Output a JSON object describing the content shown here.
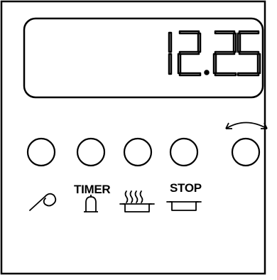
{
  "display": {
    "time": "12.25"
  },
  "labels": {
    "timer": "TIMER",
    "stop": "STOP"
  },
  "buttons": [
    {
      "id": "probe",
      "icon": "probe-icon"
    },
    {
      "id": "timer",
      "icon": "bell-icon"
    },
    {
      "id": "cook",
      "icon": "pot-steam-icon"
    },
    {
      "id": "stop",
      "icon": "pot-icon"
    }
  ],
  "knob": {
    "icon": "rotate-arrow-icon"
  },
  "colors": {
    "line": "#000000",
    "background": "#ffffff"
  }
}
